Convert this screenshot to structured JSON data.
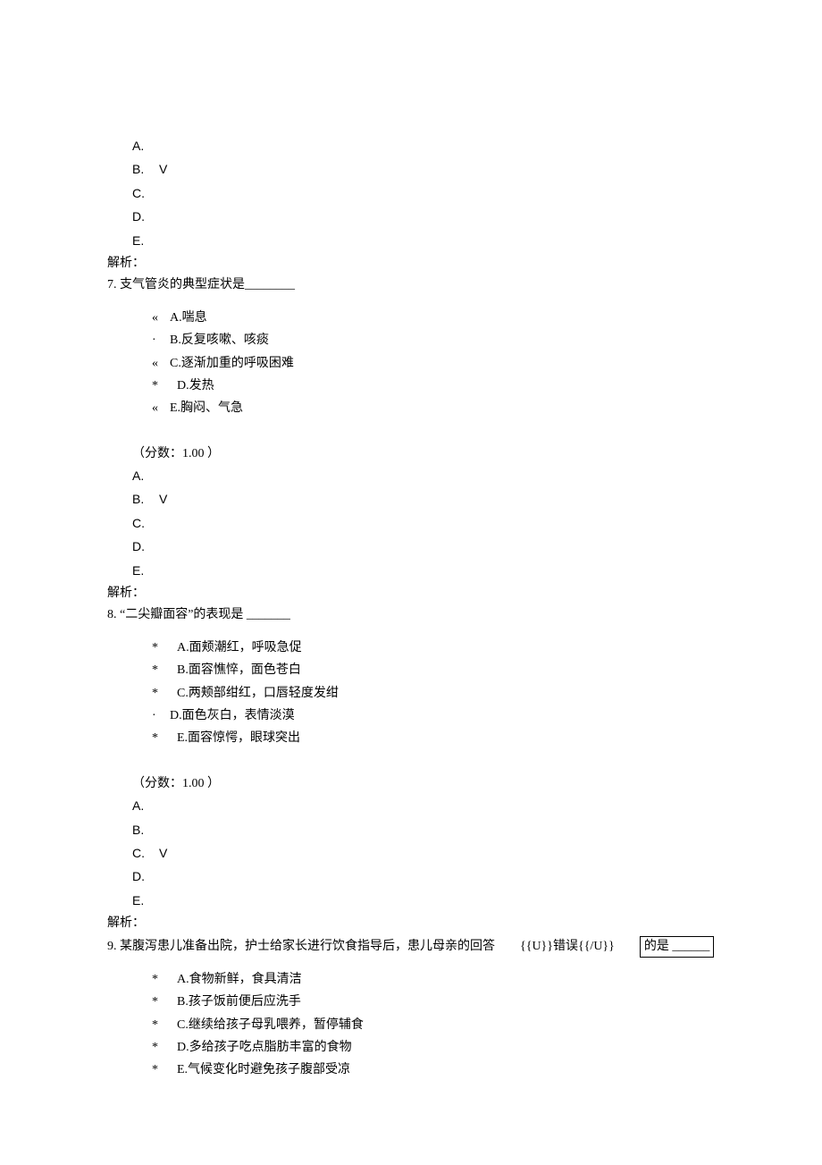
{
  "block1_answers": {
    "a": "A.",
    "b": "B.",
    "b_mark": "V",
    "c": "C.",
    "d": "D.",
    "e": "E."
  },
  "explain_label": "解析：",
  "q7": {
    "line": "7. 支气管炎的典型症状是________",
    "opts": {
      "a_pre": "«",
      "a": "A.喘息",
      "b_pre": "·",
      "b": "B.反复咳嗽、咳痰",
      "c_pre": "«",
      "c": "C.逐渐加重的呼吸困难",
      "d_pre": "*",
      "d": "D.发热",
      "e_pre": "«",
      "e": "E.胸闷、气急"
    },
    "score": "（分数：1.00 ）",
    "answers": {
      "a": "A.",
      "b": "B.",
      "b_mark": "V",
      "c": "C.",
      "d": "D.",
      "e": "E."
    }
  },
  "q8": {
    "line": "8. “二尖瓣面容”的表现是  _______",
    "opts": {
      "a_pre": "*",
      "a": "A.面颊潮红，呼吸急促",
      "b_pre": "*",
      "b": "B.面容憔悴，面色苍白",
      "c_pre": "*",
      "c": "C.两颊部绀红，口唇轻度发绀",
      "d_pre": "·",
      "d": "D.面色灰白，表情淡漠",
      "e_pre": "*",
      "e": "E.面容惊愕，眼球突出"
    },
    "score": "（分数：1.00 ）",
    "answers": {
      "a": "A.",
      "b": "B.",
      "c": "C.",
      "c_mark": "V",
      "d": "D.",
      "e": "E."
    }
  },
  "q9": {
    "text": "9. 某腹泻患儿准备出院，护士给家长进行饮食指导后，患儿母亲的回答",
    "tag": "{{U}}错误{{/U}}",
    "box": "的是 ______",
    "opts": {
      "a_pre": "*",
      "a": "A.食物新鲜，食具清洁",
      "b_pre": "*",
      "b": "B.孩子饭前便后应洗手",
      "c_pre": "*",
      "c": "C.继续给孩子母乳喂养，暂停辅食",
      "d_pre": "*",
      "d": "D.多给孩子吃点脂肪丰富的食物",
      "e_pre": "*",
      "e": "E.气候变化时避免孩子腹部受凉"
    }
  }
}
